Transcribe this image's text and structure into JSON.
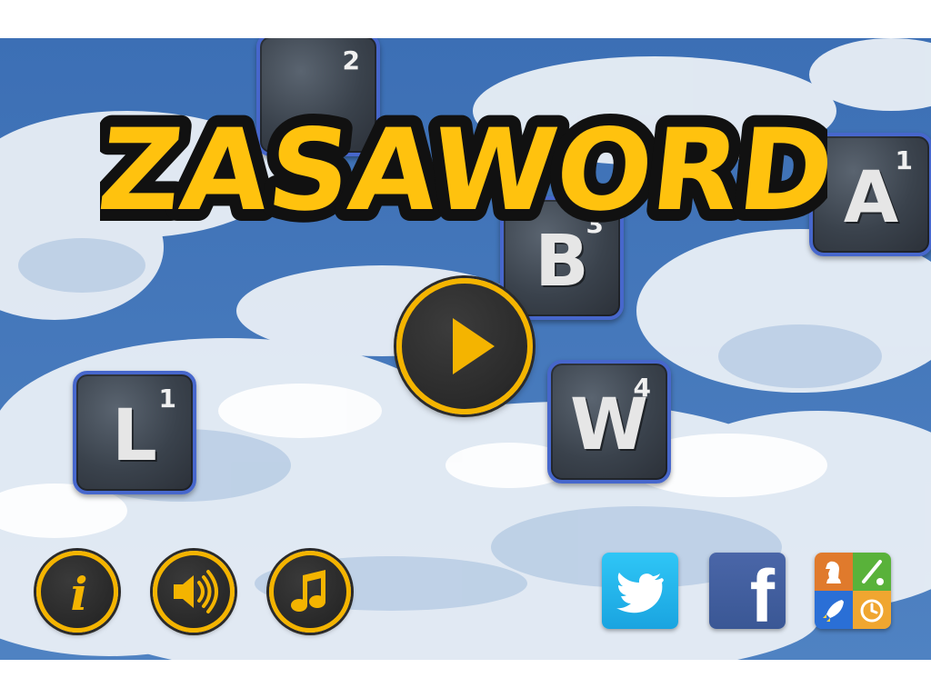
{
  "game": {
    "title": "ZASAWORD",
    "title_color": "#ffc20e",
    "title_outline_color": "#111111"
  },
  "tiles": [
    {
      "letter": "",
      "score": "2"
    },
    {
      "letter": "A",
      "score": "1"
    },
    {
      "letter": "B",
      "score": "3"
    },
    {
      "letter": "L",
      "score": "1"
    },
    {
      "letter": "W",
      "score": "4"
    }
  ],
  "buttons": {
    "play": {
      "icon": "play-icon"
    },
    "info": {
      "icon": "info-icon",
      "glyph": "i"
    },
    "sound": {
      "icon": "speaker-icon"
    },
    "music": {
      "icon": "music-note-icon"
    },
    "twitter": {
      "icon": "twitter-bird-icon"
    },
    "facebook": {
      "icon": "facebook-icon",
      "glyph": "f"
    },
    "more_apps": {
      "icon": "more-apps-icon"
    }
  },
  "colors": {
    "accent": "#f4b400",
    "tile_border": "#4767cc",
    "sky": "#3f73b8",
    "twitter": "#1da1f2",
    "facebook": "#3b5998"
  }
}
